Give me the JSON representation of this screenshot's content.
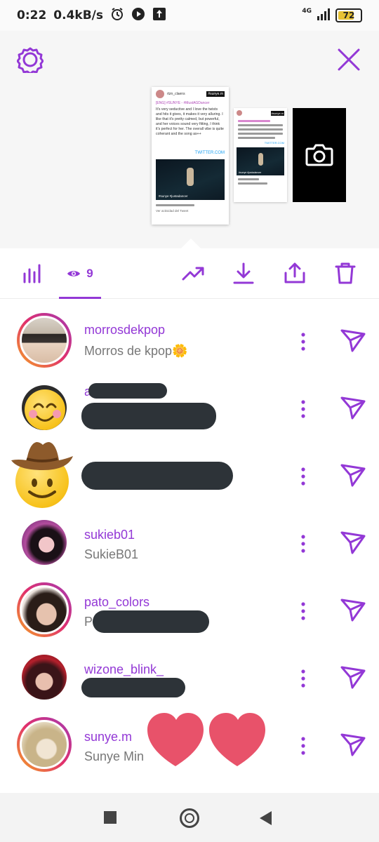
{
  "status_bar": {
    "time": "0:22",
    "speed": "0.4kB/s",
    "network": "4G",
    "battery": "72",
    "battery_level": 0.72
  },
  "preview": {
    "main_card": {
      "handle": "rtzn_claens",
      "tag": "[ENG]",
      "tag_link": "#SUNYE - #MustAGDancer",
      "body": "It's very seductive and I love the twists and hits it gives, it makes it very alluring. I like that it's pretty calmed, but powerful, and her voices sound very fitting, I think it's perfect for her. The overall vibe is quite coherant and the song as++",
      "watermark": "TWITTER.COM",
      "hashtag": "#sunye #justadancer",
      "sticker": "#sunye.m",
      "footer": "Ver actividad del Tweet"
    },
    "small_card": {
      "sticker": "#sunye.m",
      "watermark": "TWITTER.COM",
      "hashtag": "#sunye #justadancer"
    },
    "camera_icon": "camera-icon"
  },
  "toolbar": {
    "views_count": "9",
    "icons": [
      "bar-chart-icon",
      "eye-icon",
      "trending-icon",
      "download-icon",
      "share-icon",
      "trash-icon"
    ]
  },
  "viewers": [
    {
      "username": "morrosdekpop",
      "fullname": "Morros de kpop🌼",
      "ring": true
    },
    {
      "username": "a",
      "fullname": "",
      "ring": false
    },
    {
      "username": "",
      "fullname": "",
      "ring": false
    },
    {
      "username": "sukieb01",
      "fullname": "SukieB01",
      "ring": false
    },
    {
      "username": "pato_colors",
      "fullname": "P",
      "ring": true
    },
    {
      "username": "wizone_blink_",
      "fullname": "",
      "ring": false
    },
    {
      "username": "sunye.m",
      "fullname": "Sunye Min",
      "ring": true
    }
  ],
  "colors": {
    "accent": "#9338d6",
    "redaction": "#2d3338",
    "heart": "#e8526a"
  }
}
